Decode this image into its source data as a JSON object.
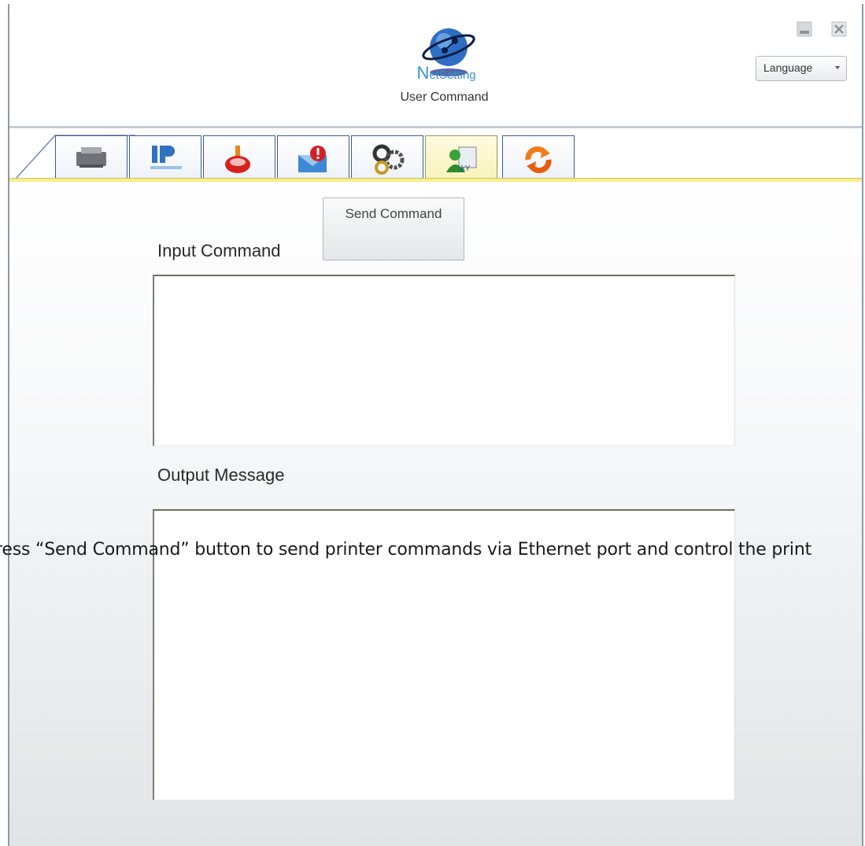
{
  "header": {
    "logo_text_initial": "N",
    "logo_text_rest": "etSetting",
    "page_subtitle": "User Command",
    "language_label": "Language",
    "minimize_icon": "minimize-icon",
    "close_icon": "close-icon"
  },
  "tabs": [
    {
      "icon": "printer-icon",
      "active": false
    },
    {
      "icon": "ip-network-icon",
      "active": false
    },
    {
      "icon": "alert-bell-icon",
      "active": false
    },
    {
      "icon": "email-alert-icon",
      "active": false
    },
    {
      "icon": "gear-settings-icon",
      "active": false
    },
    {
      "icon": "user-command-icon",
      "active": true
    },
    {
      "icon": "refresh-icon",
      "active": false
    }
  ],
  "main": {
    "send_command_label": "Send Command",
    "input_label": "Input Command",
    "input_value": "",
    "output_label": "Output Message",
    "output_value": ""
  },
  "caption": "ress “Send Command” button to send printer commands via Ethernet port and control the print",
  "colors": {
    "tab_border": "#3b5a9a",
    "active_tab": "#f7f2b8",
    "accent_logo": "#3a8fd0"
  }
}
